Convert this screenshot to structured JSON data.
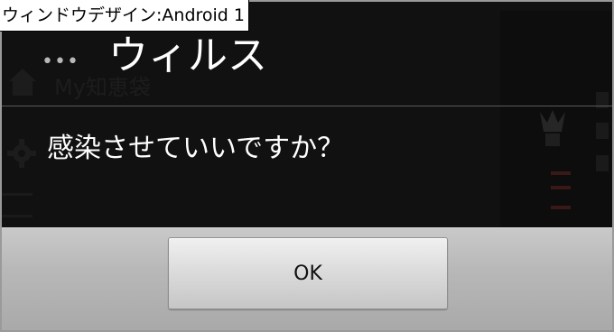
{
  "caption": {
    "text": "ウィンドウデザイン:Android 1"
  },
  "background_app": {
    "overflow_icon": "more-dots-icon",
    "home_icon": "home-icon",
    "settings_icon": "gear-icon",
    "title_partial": "My知恵袋"
  },
  "dialog": {
    "title": "ウィルス",
    "message": "感染させていいですか？",
    "ok_label": "OK"
  },
  "colors": {
    "dialog_background": "#0a0a0a",
    "dialog_text": "#ffffff",
    "button_bar": "#b8b8b8",
    "button_face": "#dadada",
    "frame_border": "#9a9a9a"
  }
}
